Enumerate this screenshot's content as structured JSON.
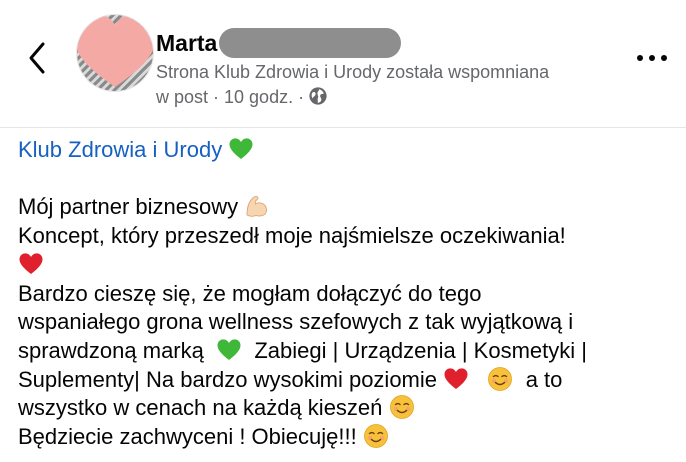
{
  "post": {
    "author_name": "Marta",
    "meta_line1": "Strona Klub Zdrowia i Urody została wspomniana",
    "meta_line2": "w post · 10 godz. ·",
    "page_link": "Klub Zdrowia i Urody",
    "text": {
      "l1": "Mój partner biznesowy",
      "l2": "Koncept, który przeszedł moje najśmielsze oczekiwania!",
      "l4": "Bardzo cieszę się, że mogłam dołączyć do tego",
      "l5": "wspaniałego grona wellness szefowych z tak wyjątkową i",
      "l6a": "sprawdzoną marką",
      "l6b": "Zabiegi | Urządzenia | Kosmetyki |",
      "l7": "Suplementy| Na bardzo wysokimi poziomie",
      "l8a": "wszystko w cenach na każdą kieszeń",
      "l7tail": "a to",
      "l9": "Będziecie zachwyceni ! Obiecuję!!!"
    }
  },
  "icons": {
    "back": "chevron-left-icon",
    "more": "more-horizontal-icon",
    "globe": "globe-icon",
    "green_heart": "green-heart-emoji",
    "red_heart": "red-heart-emoji",
    "smile": "smiling-face-emoji",
    "muscle": "flexed-biceps-emoji"
  },
  "colors": {
    "link": "#1660c2",
    "meta": "#65676b",
    "green_heart": "#3fb83a",
    "red_heart": "#e0202c",
    "smile": "#f7c23a",
    "avatar_heart": "#f4a9a5"
  }
}
